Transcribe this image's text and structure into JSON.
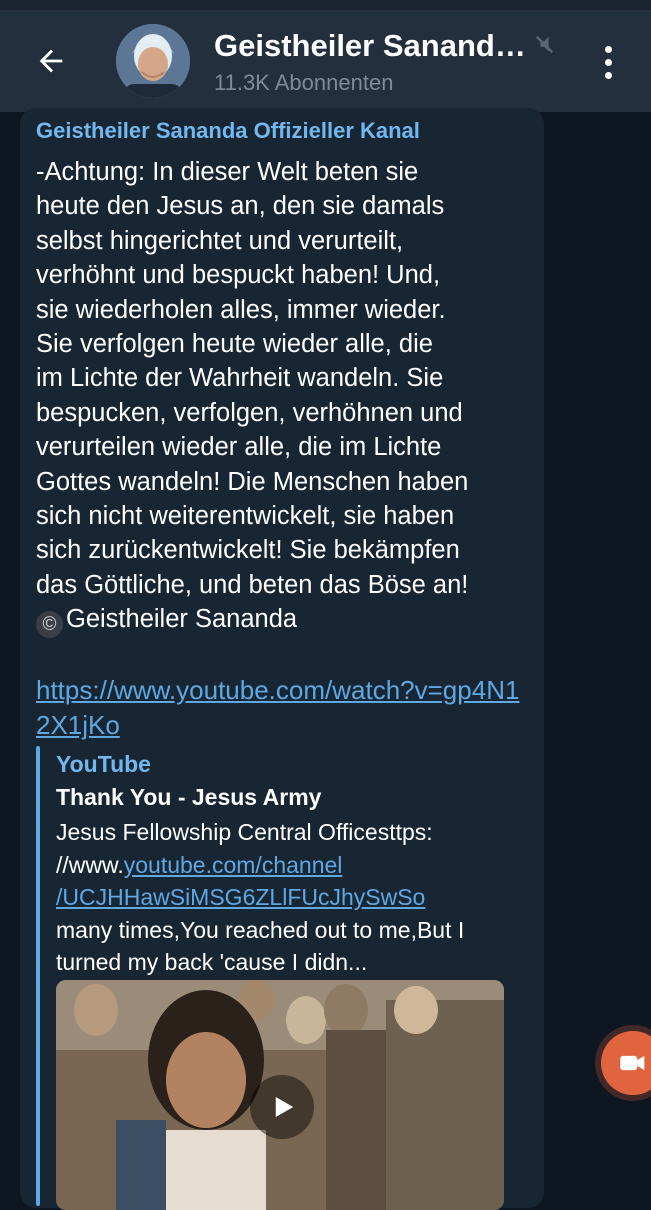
{
  "header": {
    "title": "Geistheiler Sananda Offizieller Kanal",
    "subscribers": "11.3K Abonnenten"
  },
  "message": {
    "sender": "Geistheiler Sananda Offizieller Kanal",
    "text": "-Achtung: In dieser Welt beten sie\nheute den Jesus an, den sie damals\nselbst hingerichtet und verurteilt,\nverhöhnt und bespuckt haben! Und,\nsie wiederholen alles, immer wieder.\nSie verfolgen heute wieder alle, die\nim Lichte der Wahrheit wandeln. Sie\nbespucken, verfolgen, verhöhnen und\nverurteilen wieder alle, die im Lichte\nGottes wandeln! Die Menschen haben\nsich nicht weiterentwickelt, sie haben\nsich zurückentwickelt! Sie bekämpfen\ndas Göttliche, und beten das Böse an!",
    "copyright_symbol": "©",
    "signature": "Geistheiler Sananda",
    "link": "https://www.youtube.com/watch?v=gp4N12X1jKo"
  },
  "preview": {
    "site": "YouTube",
    "title": "Thank You - Jesus Army",
    "desc_part1": "Jesus Fellowship Central Officesttps: //www.",
    "desc_link1": "youtube.com/channel",
    "desc_link2": "/UCJHHawSiMSG6ZLlFUcJhySwSo",
    "desc_part2": "many times,You reached out to me,But I turned my back 'cause I didn..."
  },
  "colors": {
    "header_bg": "#242f3d",
    "bubble_bg": "#182533",
    "accent": "#71b8f1",
    "link": "#5ea8e4",
    "fab": "#e0653f"
  },
  "icons": [
    "back-arrow-icon",
    "mute-icon",
    "more-vertical-icon",
    "play-icon",
    "video-chat-icon"
  ]
}
